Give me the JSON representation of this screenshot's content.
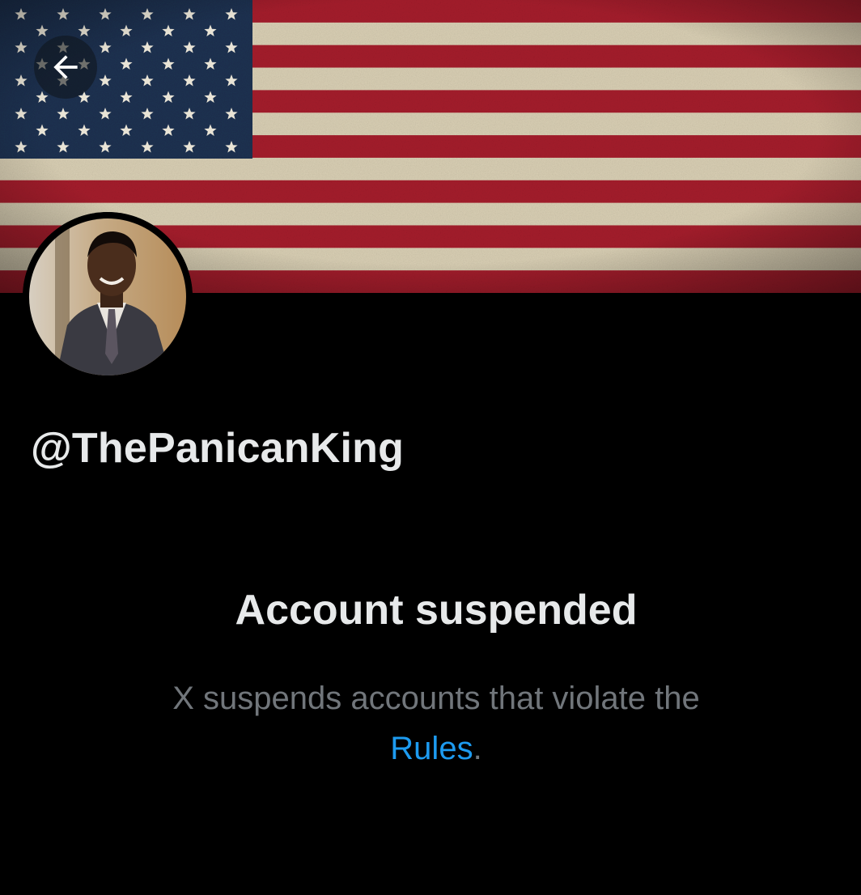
{
  "profile": {
    "handle": "@ThePanicanKing",
    "banner_icon": "american-flag",
    "avatar_icon": "profile-photo"
  },
  "navigation": {
    "back_icon": "arrow-left-icon"
  },
  "notice": {
    "title": "Account suspended",
    "body_prefix": "X suspends accounts that violate the",
    "link_text": "Rules",
    "body_suffix": "."
  },
  "colors": {
    "background": "#000000",
    "text_primary": "#e7e9ea",
    "text_secondary": "#71767b",
    "link": "#1d9bf0",
    "flag_red": "#a51c2c",
    "flag_white": "#d9cfb4",
    "flag_blue": "#1f3251"
  }
}
